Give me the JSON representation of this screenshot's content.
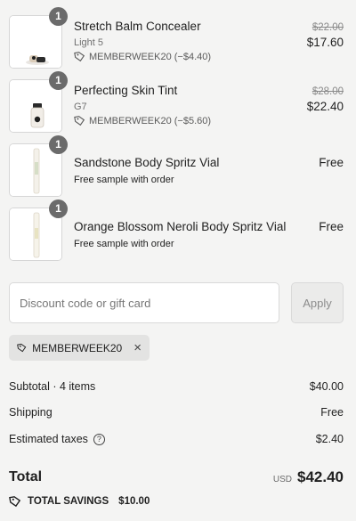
{
  "line_items": [
    {
      "name": "Stretch Balm Concealer",
      "quantity": "1",
      "variant": "Light 5",
      "discount": "MEMBERWEEK20 (−$4.40)",
      "original_price": "$22.00",
      "price": "$17.60"
    },
    {
      "name": "Perfecting Skin Tint",
      "quantity": "1",
      "variant": "G7",
      "discount": "MEMBERWEEK20 (−$5.60)",
      "original_price": "$28.00",
      "price": "$22.40"
    },
    {
      "name": "Sandstone Body Spritz Vial",
      "quantity": "1",
      "note": "Free sample with order",
      "price": "Free"
    },
    {
      "name": "Orange Blossom Neroli Body Spritz Vial",
      "quantity": "1",
      "note": "Free sample with order",
      "price": "Free"
    }
  ],
  "discount": {
    "placeholder": "Discount code or gift card",
    "apply_label": "Apply",
    "applied_code": "MEMBERWEEK20"
  },
  "summary": {
    "subtotal_label": "Subtotal · 4 items",
    "subtotal_value": "$40.00",
    "shipping_label": "Shipping",
    "shipping_value": "Free",
    "taxes_label": "Estimated taxes",
    "taxes_value": "$2.40",
    "help_symbol": "?",
    "total_label": "Total",
    "currency": "USD",
    "total_value": "$42.40",
    "savings_label": "TOTAL SAVINGS",
    "savings_value": "$10.00"
  },
  "icons": {
    "tag": "tag-icon",
    "remove": "×",
    "help": "help-circle-icon"
  },
  "colors": {
    "background": "#f4f4f3",
    "badge": "#6b6b6b",
    "text": "#1f1f1f",
    "muted": "#707070"
  }
}
